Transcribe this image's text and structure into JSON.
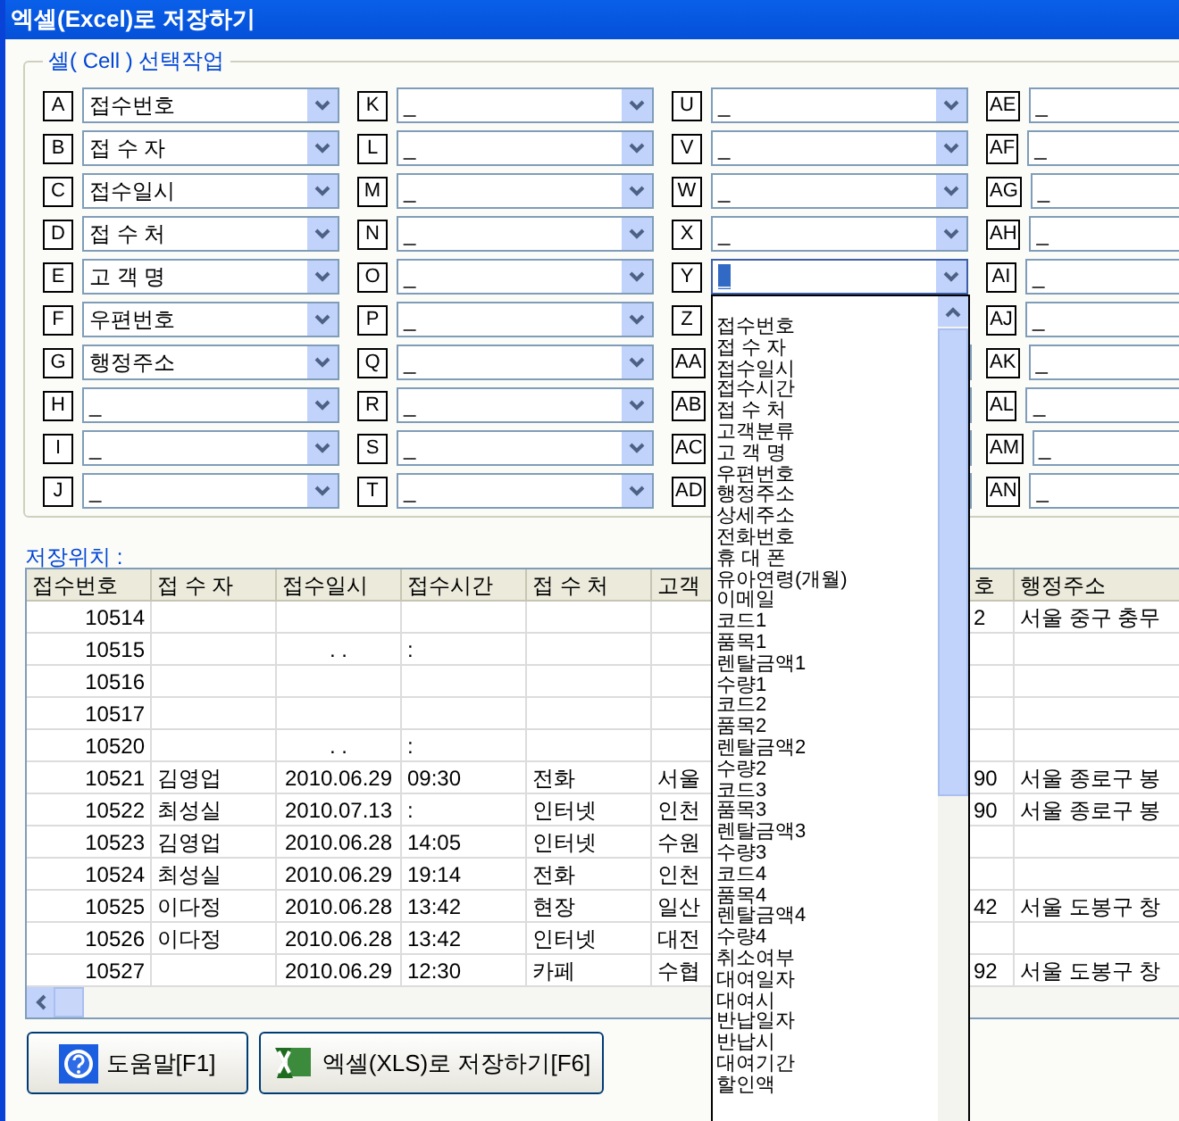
{
  "window": {
    "title": "엑셀(Excel)로 저장하기"
  },
  "cell_group": {
    "title": "셀( Cell ) 선택작업",
    "cells": [
      {
        "letter": "A",
        "value": "접수번호",
        "open": false
      },
      {
        "letter": "B",
        "value": "접 수 자",
        "open": false
      },
      {
        "letter": "C",
        "value": "접수일시",
        "open": false
      },
      {
        "letter": "D",
        "value": "접 수 처",
        "open": false
      },
      {
        "letter": "E",
        "value": "고 객 명",
        "open": false
      },
      {
        "letter": "F",
        "value": "우편번호",
        "open": false
      },
      {
        "letter": "G",
        "value": "행정주소",
        "open": false
      },
      {
        "letter": "H",
        "value": "_",
        "open": false
      },
      {
        "letter": "I",
        "value": "_",
        "open": false
      },
      {
        "letter": "J",
        "value": "_",
        "open": false
      },
      {
        "letter": "K",
        "value": "_",
        "open": false
      },
      {
        "letter": "L",
        "value": "_",
        "open": false
      },
      {
        "letter": "M",
        "value": "_",
        "open": false
      },
      {
        "letter": "N",
        "value": "_",
        "open": false
      },
      {
        "letter": "O",
        "value": "_",
        "open": false
      },
      {
        "letter": "P",
        "value": "_",
        "open": false
      },
      {
        "letter": "Q",
        "value": "_",
        "open": false
      },
      {
        "letter": "R",
        "value": "_",
        "open": false
      },
      {
        "letter": "S",
        "value": "_",
        "open": false
      },
      {
        "letter": "T",
        "value": "_",
        "open": false
      },
      {
        "letter": "U",
        "value": "_",
        "open": false
      },
      {
        "letter": "V",
        "value": "_",
        "open": false
      },
      {
        "letter": "W",
        "value": "_",
        "open": false
      },
      {
        "letter": "X",
        "value": "_",
        "open": false
      },
      {
        "letter": "Y",
        "value": "_",
        "open": true,
        "options": [
          "접수번호",
          "접 수 자",
          "접수일시",
          "접수시간",
          "접 수 처",
          "고객분류",
          "고 객 명",
          "우편번호",
          "행정주소",
          "상세주소",
          "전화번호",
          "휴 대 폰",
          "유아연령(개월)",
          "이메일",
          "코드1",
          "품목1",
          "렌탈금액1",
          "수량1",
          "코드2",
          "품목2",
          "렌탈금액2",
          "수량2",
          "코드3",
          "품목3",
          "렌탈금액3",
          "수량3",
          "코드4",
          "품목4",
          "렌탈금액4",
          "수량4",
          "취소여부",
          "대여일자",
          "대여시",
          "반납일자",
          "반납시",
          "대여기간",
          "할인액"
        ]
      },
      {
        "letter": "Z",
        "open": false
      },
      {
        "letter": "AA",
        "open": false
      },
      {
        "letter": "AB",
        "open": false
      },
      {
        "letter": "AC",
        "open": false
      },
      {
        "letter": "AD",
        "open": false
      },
      {
        "letter": "AE",
        "value": "_",
        "open": false
      },
      {
        "letter": "AF",
        "value": "_",
        "open": false
      },
      {
        "letter": "AG",
        "value": "_",
        "open": false
      },
      {
        "letter": "AH",
        "value": "_",
        "open": false
      },
      {
        "letter": "AI",
        "value": "_",
        "open": false
      },
      {
        "letter": "AJ",
        "value": "_",
        "open": false
      },
      {
        "letter": "AK",
        "value": "_",
        "open": false
      },
      {
        "letter": "AL",
        "value": "_",
        "open": false
      },
      {
        "letter": "AM",
        "value": "_",
        "open": false
      },
      {
        "letter": "AN",
        "value": "_",
        "open": false
      }
    ]
  },
  "save_location_label": "저장위치 :",
  "table": {
    "columns": [
      "접수번호",
      "접 수 자",
      "접수일시",
      "접수시간",
      "접 수 처",
      "고객",
      null,
      "호",
      "행정주소"
    ],
    "rows": [
      [
        "10514",
        null,
        null,
        null,
        null,
        null,
        null,
        "2",
        "서울 중구 충무"
      ],
      [
        "10515",
        null,
        ". .",
        ":",
        null,
        null,
        null,
        null,
        null
      ],
      [
        "10516",
        null,
        null,
        null,
        null,
        null,
        null,
        null,
        null
      ],
      [
        "10517",
        null,
        null,
        null,
        null,
        null,
        null,
        null,
        null
      ],
      [
        "10520",
        null,
        ". .",
        ":",
        null,
        null,
        null,
        null,
        null
      ],
      [
        "10521",
        "김영업",
        "2010.06.29",
        "09:30",
        "전화",
        "서울",
        null,
        "90",
        "서울 종로구 봉"
      ],
      [
        "10522",
        "최성실",
        "2010.07.13",
        ":",
        "인터넷",
        "인천",
        null,
        "90",
        "서울 종로구 봉"
      ],
      [
        "10523",
        "김영업",
        "2010.06.28",
        "14:05",
        "인터넷",
        "수원",
        null,
        null,
        null
      ],
      [
        "10524",
        "최성실",
        "2010.06.29",
        "19:14",
        "전화",
        "인천",
        null,
        null,
        null
      ],
      [
        "10525",
        "이다정",
        "2010.06.28",
        "13:42",
        "현장",
        "일산",
        null,
        "42",
        "서울 도봉구 창"
      ],
      [
        "10526",
        "이다정",
        "2010.06.28",
        "13:42",
        "인터넷",
        "대전",
        null,
        null,
        null
      ],
      [
        "10527",
        null,
        "2010.06.29",
        "12:30",
        "카페",
        "수협",
        null,
        "92",
        "서울 도봉구 창"
      ]
    ]
  },
  "buttons": [
    {
      "kind": "help",
      "label": "도움말[F1]"
    },
    {
      "kind": "excel",
      "label": "엑셀(XLS)로 저장하기[F6]"
    }
  ]
}
